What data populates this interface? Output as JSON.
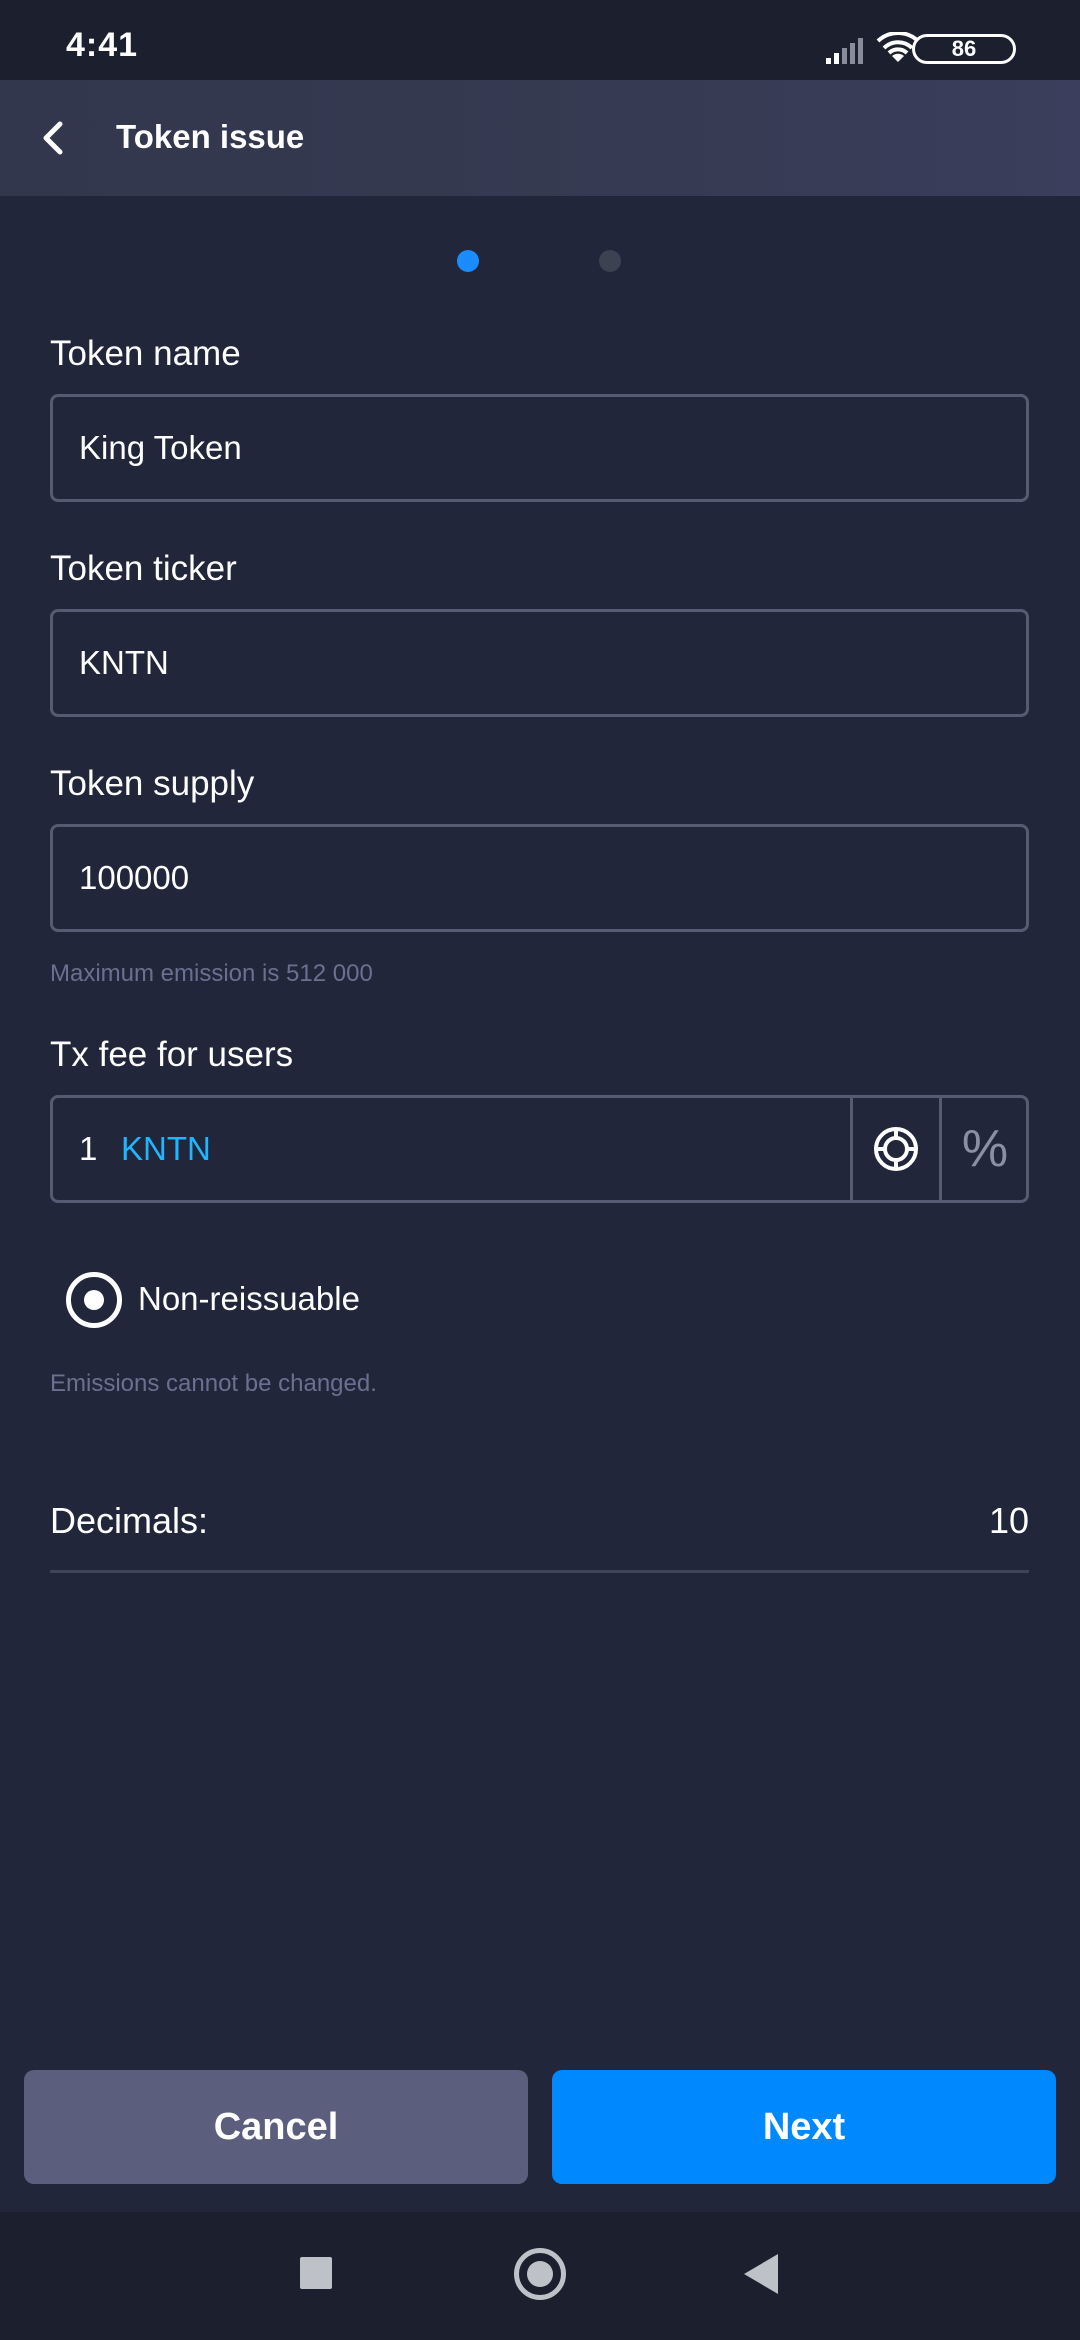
{
  "status_bar": {
    "time": "4:41",
    "battery": "86",
    "icons": [
      "signal-icon",
      "wifi-icon",
      "battery-icon"
    ]
  },
  "header": {
    "back_icon": "chevron-left-icon",
    "title": "Token issue"
  },
  "stepper": {
    "current_step": 1,
    "total_steps": 2
  },
  "form": {
    "token_name": {
      "label": "Token name",
      "value": "King Token"
    },
    "token_ticker": {
      "label": "Token ticker",
      "value": "KNTN"
    },
    "token_supply": {
      "label": "Token supply",
      "value": "100000",
      "hint": "Maximum emission is 512 000"
    },
    "tx_fee": {
      "label": "Tx fee for users",
      "value": "1",
      "unit": "KNTN",
      "token_icon": "token-coin-icon",
      "percent_symbol": "%"
    },
    "reissuable": {
      "label": "Non-reissuable",
      "selected": true,
      "hint": "Emissions cannot be changed."
    },
    "decimals": {
      "label": "Decimals:",
      "value": "10"
    }
  },
  "actions": {
    "cancel_label": "Cancel",
    "next_label": "Next"
  },
  "colors": {
    "accent": "#0088ff",
    "ticker": "#1fb6ff",
    "background": "#22263a",
    "cancel_bg": "#5b5f7d"
  },
  "nav_bar": {
    "icons": [
      "recent-apps-icon",
      "home-icon",
      "back-icon"
    ]
  }
}
